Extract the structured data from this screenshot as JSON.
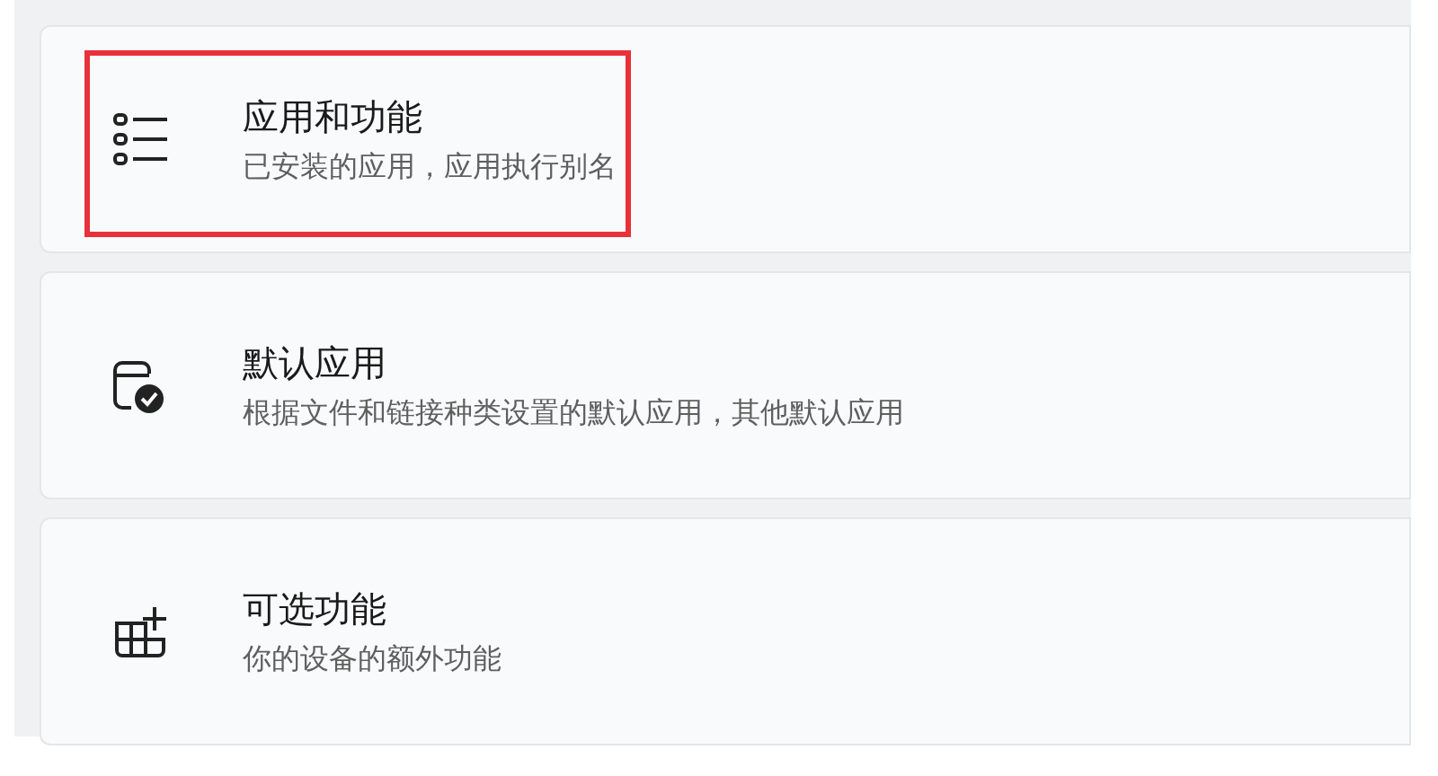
{
  "items": [
    {
      "kind": "list",
      "title": "应用和功能",
      "description": "已安装的应用，应用执行别名",
      "highlighted": true
    },
    {
      "kind": "default",
      "title": "默认应用",
      "description": "根据文件和链接种类设置的默认应用，其他默认应用",
      "highlighted": false
    },
    {
      "kind": "optional",
      "title": "可选功能",
      "description": "你的设备的额外功能",
      "highlighted": false
    }
  ]
}
